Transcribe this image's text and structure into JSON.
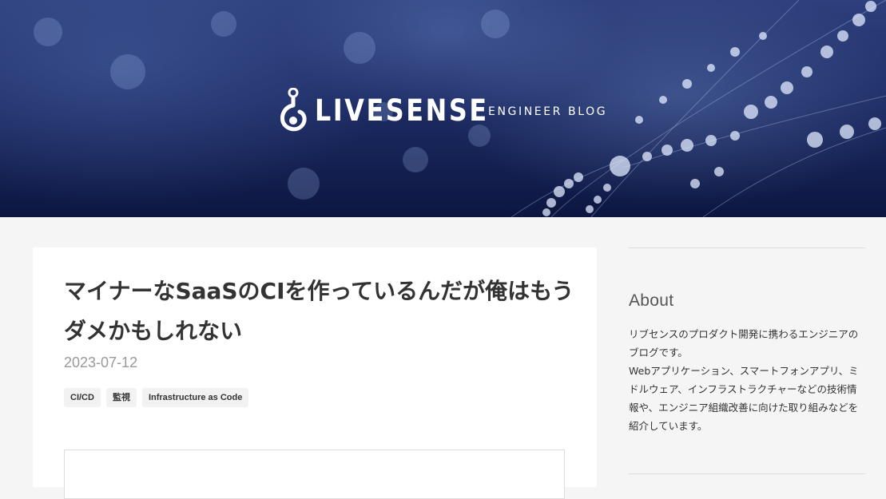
{
  "header": {
    "brand_name": "LIVESENSE",
    "brand_sub": "ENGINEER  BLOG",
    "logo_icon": "livesense-hook-logo-icon",
    "background": "dew-drops-on-spider-web-photo"
  },
  "article": {
    "title": "マイナーなSaaSのCIを作っているんだが俺はもうダメかもしれない",
    "date": "2023-07-12",
    "tags": [
      "CI/CD",
      "監視",
      "Infrastructure as Code"
    ]
  },
  "sidebar": {
    "about_heading": "About",
    "about_text_1": "リブセンスのプロダクト開発に携わるエンジニアのブログです。",
    "about_text_2": "Webアプリケーション、スマートフォンアプリ、ミドルウェア、インフラストラクチャーなどの技術情報や、エンジニア組織改善に向けた取り組みなどを紹介しています。"
  },
  "colors": {
    "page_bg": "#f5f5f5",
    "card_bg": "#ffffff",
    "hero_navy": "#1e2d66",
    "date_gray": "#999999",
    "tag_bg": "#f2f2f2"
  }
}
